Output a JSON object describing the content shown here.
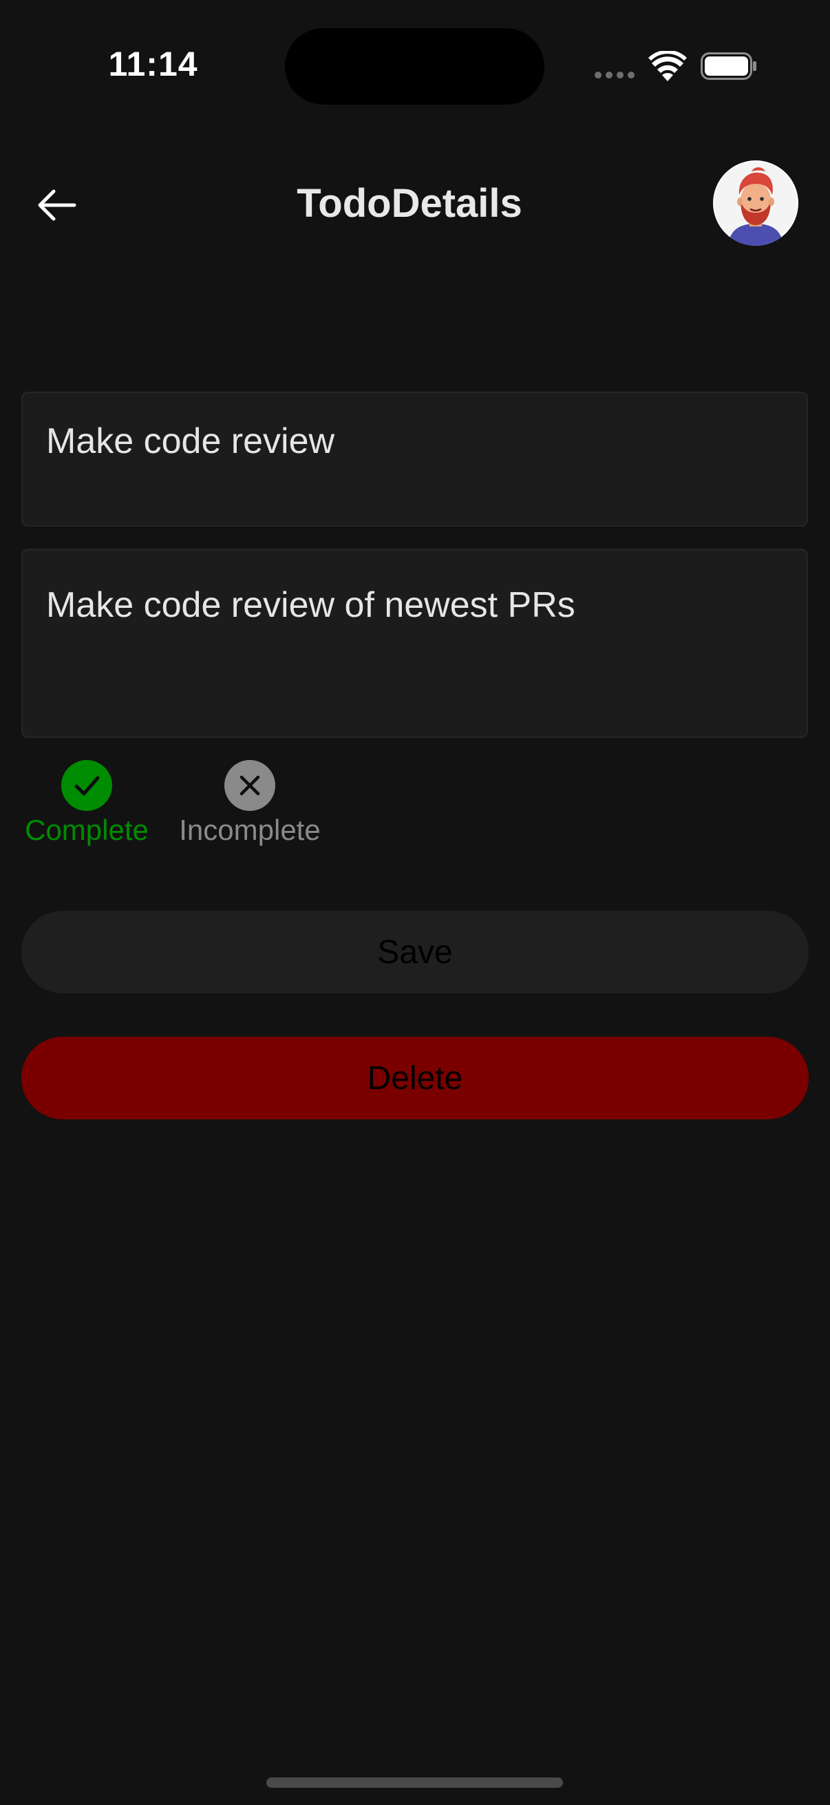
{
  "status_bar": {
    "time": "11:14"
  },
  "header": {
    "title": "TodoDetails",
    "back_icon": "arrow-left-icon",
    "avatar_icon": "user-avatar-illustration"
  },
  "form": {
    "title_value": "Make code review",
    "description_value": "Make code review of newest PRs"
  },
  "status": {
    "complete_label": "Complete",
    "incomplete_label": "Incomplete",
    "selected": "complete",
    "complete_color": "#008c00",
    "incomplete_color": "#8a8a8a"
  },
  "actions": {
    "save_label": "Save",
    "delete_label": "Delete",
    "delete_color": "#7a0000"
  }
}
